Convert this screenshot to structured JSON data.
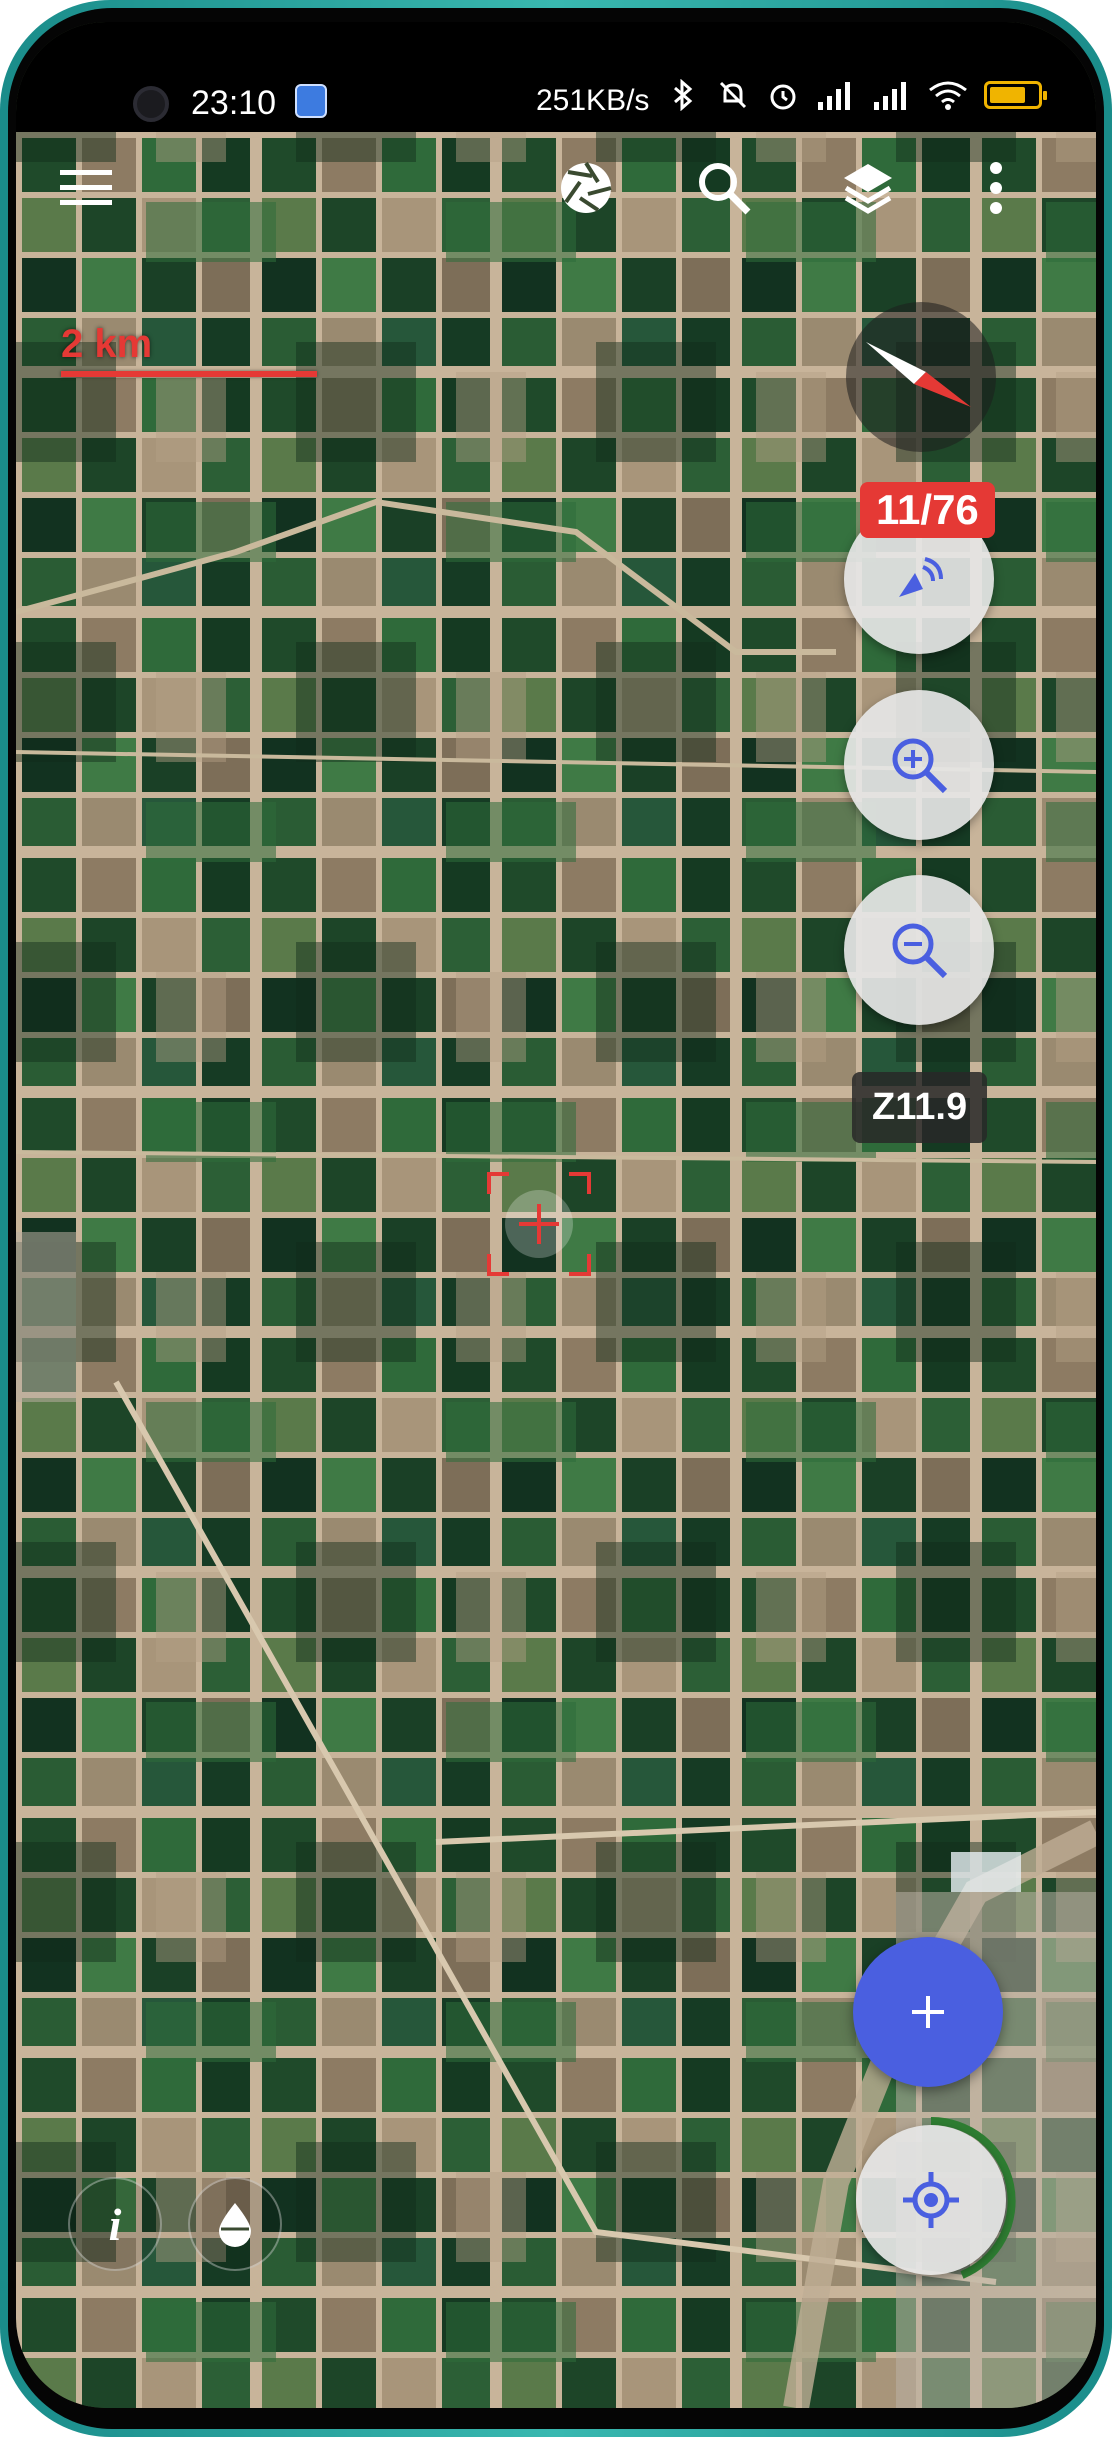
{
  "status_bar": {
    "time": "23:10",
    "network_speed": "251KB/s",
    "icons": [
      "shield-icon",
      "bluetooth-icon",
      "notifications-off-icon",
      "alarm-icon",
      "signal-icon",
      "signal-icon",
      "wifi-icon",
      "battery-icon"
    ],
    "battery_level": 0.75,
    "battery_color": "#f0b400"
  },
  "toolbar": {
    "icons": [
      "menu-icon",
      "aperture-icon",
      "search-icon",
      "layers-icon",
      "more-vert-icon"
    ]
  },
  "map": {
    "scale_label": "2 km",
    "scale_color": "#e53935",
    "satellites_badge": "11/76",
    "zoom_level": "Z11.9",
    "accent_color": "#4a5fe0"
  },
  "buttons": {
    "gps_status_icon": "satellite-icon",
    "zoom_in_icon": "zoom-in-icon",
    "zoom_out_icon": "zoom-out-icon",
    "add_icon": "plus-icon",
    "locate_icon": "my-location-icon",
    "info_label": "i",
    "water_icon": "water-drop-icon"
  }
}
